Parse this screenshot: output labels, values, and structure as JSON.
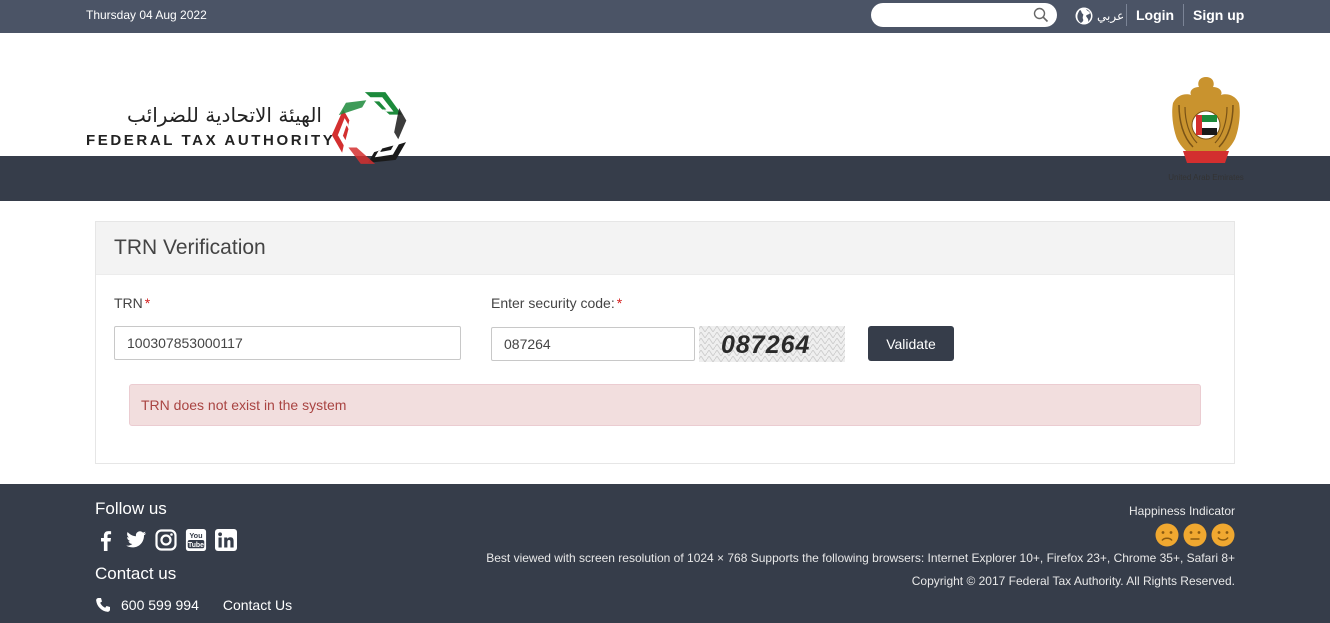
{
  "topbar": {
    "date": "Thursday 04 Aug 2022",
    "search_value": "",
    "search_icon": "search-icon",
    "lang_label": "عربي",
    "login_label": "Login",
    "signup_label": "Sign up",
    "bg_color": "#4b5466"
  },
  "header": {
    "logo_arabic": "الهيئة الاتحادية للضرائب",
    "logo_english": "FEDERAL TAX AUTHORITY",
    "emblem_caption": "United Arab Emirates",
    "emblem_arabic": "الإمارات العربية المتحدة"
  },
  "form": {
    "title": "TRN Verification",
    "trn_label": "TRN",
    "trn_value": "100307853000117",
    "code_label": "Enter security code:",
    "code_value": "087264",
    "captcha_text": "087264",
    "required_mark": "*",
    "validate_label": "Validate",
    "error_message": "TRN does not exist in the system"
  },
  "footer": {
    "follow_title": "Follow us",
    "social_icons": [
      "facebook-icon",
      "twitter-icon",
      "instagram-icon",
      "youtube-icon",
      "linkedin-icon"
    ],
    "youtube_text": "You Tube",
    "contact_title": "Contact us",
    "phone": "600 599 994",
    "contact_link": "Contact Us",
    "happiness_title": "Happiness Indicator",
    "faces": [
      "sad-face-icon",
      "neutral-face-icon",
      "happy-face-icon"
    ],
    "browsers_text": "Best viewed with screen resolution of 1024 × 768 Supports the following browsers: Internet Explorer 10+, Firefox 23+, Chrome 35+, Safari 8+",
    "copyright": "Copyright © 2017 Federal Tax Authority. All Rights Reserved.",
    "face_color": "#f0a830"
  },
  "colors": {
    "nav_bg": "#363d4a",
    "alert_bg": "#f2dede",
    "alert_text": "#a94442",
    "required": "#d42020"
  }
}
